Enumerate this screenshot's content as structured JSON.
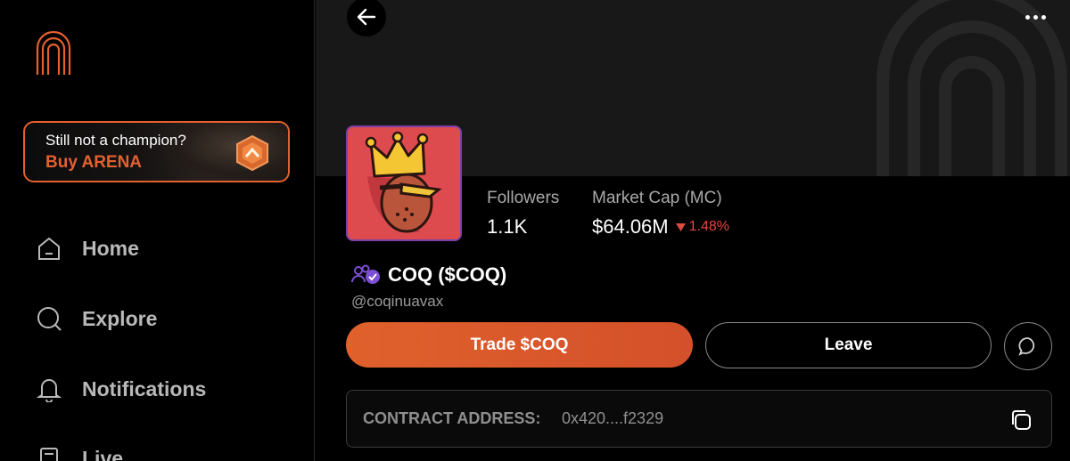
{
  "sidebar": {
    "promo": {
      "title": "Still not a champion?",
      "cta": "Buy ARENA"
    },
    "nav": [
      {
        "label": "Home",
        "icon": "home-icon"
      },
      {
        "label": "Explore",
        "icon": "search-icon"
      },
      {
        "label": "Notifications",
        "icon": "bell-icon"
      },
      {
        "label": "Live",
        "icon": "live-icon"
      }
    ]
  },
  "profile": {
    "stats": {
      "followers_label": "Followers",
      "followers_value": "1.1K",
      "mc_label": "Market Cap (MC)",
      "mc_value": "$64.06M",
      "mc_change": "1.48%"
    },
    "name": "COQ ($COQ)",
    "handle": "@coqinuavax",
    "trade_label": "Trade $COQ",
    "leave_label": "Leave",
    "contract_label": "CONTRACT ADDRESS:",
    "contract_value": "0x420....f2329"
  },
  "colors": {
    "accent": "#e3602f",
    "negative": "#e0493f",
    "avatar_bg": "#de4b4f",
    "verified": "#7b4fd6"
  }
}
